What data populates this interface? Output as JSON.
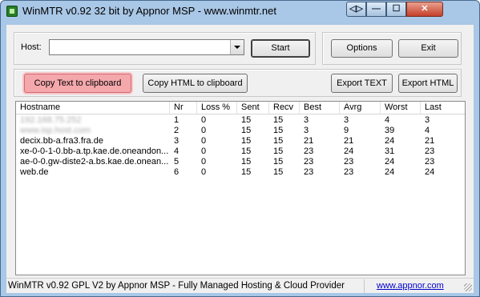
{
  "window": {
    "title": "WinMTR v0.92 32 bit by Appnor MSP - www.winmtr.net"
  },
  "titlebar_buttons": {
    "back": "◁▷",
    "minimize": "—",
    "maximize": "☐",
    "close": "✕"
  },
  "host": {
    "label": "Host:",
    "value": "",
    "placeholder": ""
  },
  "buttons": {
    "start": "Start",
    "options": "Options",
    "exit": "Exit",
    "copy_text": "Copy Text to clipboard",
    "copy_html": "Copy HTML to clipboard",
    "export_text": "Export TEXT",
    "export_html": "Export HTML"
  },
  "table": {
    "columns": [
      "Hostname",
      "Nr",
      "Loss %",
      "Sent",
      "Recv",
      "Best",
      "Avrg",
      "Worst",
      "Last"
    ],
    "rows": [
      [
        "192.168.75.252",
        "1",
        "0",
        "15",
        "15",
        "3",
        "3",
        "4",
        "3"
      ],
      [
        "www.isp.host.com",
        "2",
        "0",
        "15",
        "15",
        "3",
        "9",
        "39",
        "4"
      ],
      [
        "decix.bb-a.fra3.fra.de",
        "3",
        "0",
        "15",
        "15",
        "21",
        "21",
        "24",
        "21"
      ],
      [
        "xe-0-0-1-0.bb-a.tp.kae.de.oneandon...",
        "4",
        "0",
        "15",
        "15",
        "23",
        "24",
        "31",
        "23"
      ],
      [
        "ae-0-0.gw-diste2-a.bs.kae.de.onean...",
        "5",
        "0",
        "15",
        "15",
        "23",
        "23",
        "24",
        "23"
      ],
      [
        "web.de",
        "6",
        "0",
        "15",
        "15",
        "23",
        "23",
        "24",
        "24"
      ]
    ]
  },
  "statusbar": {
    "text": "WinMTR v0.92 GPL V2 by Appnor MSP - Fully Managed Hosting & Cloud Provider",
    "link": "www.appnor.com"
  },
  "colors": {
    "highlight_button": "#f4a8ac",
    "titlebar": "#a9c7e6",
    "link": "#0000cc"
  }
}
